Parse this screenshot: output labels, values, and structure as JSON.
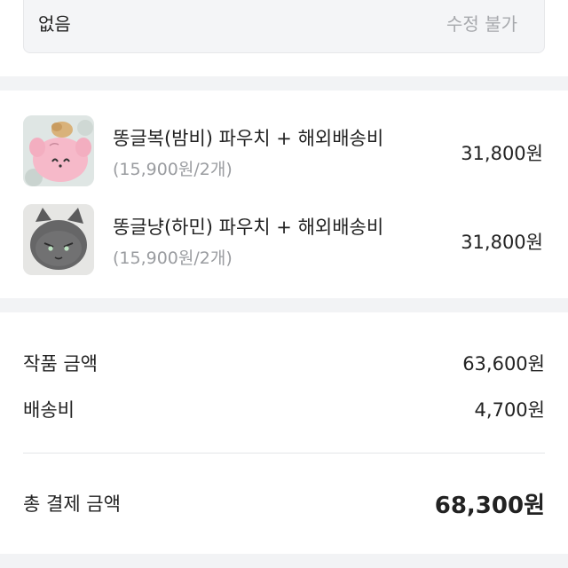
{
  "option": {
    "value": "없음",
    "status": "수정 불가"
  },
  "items": [
    {
      "name": "똥글복(밤비) 파우치 + 해외배송비",
      "sub": "(15,900원/2개)",
      "price": "31,800원",
      "thumb_icon": "pink-plush-pouch-thumbnail"
    },
    {
      "name": "똥글냥(하민) 파우치 + 해외배송비",
      "sub": "(15,900원/2개)",
      "price": "31,800원",
      "thumb_icon": "gray-cat-plush-pouch-thumbnail"
    }
  ],
  "summary": {
    "product_label": "작품 금액",
    "product_value": "63,600원",
    "shipping_label": "배송비",
    "shipping_value": "4,700원",
    "total_label": "총 결제 금액",
    "total_value": "68,300원"
  }
}
